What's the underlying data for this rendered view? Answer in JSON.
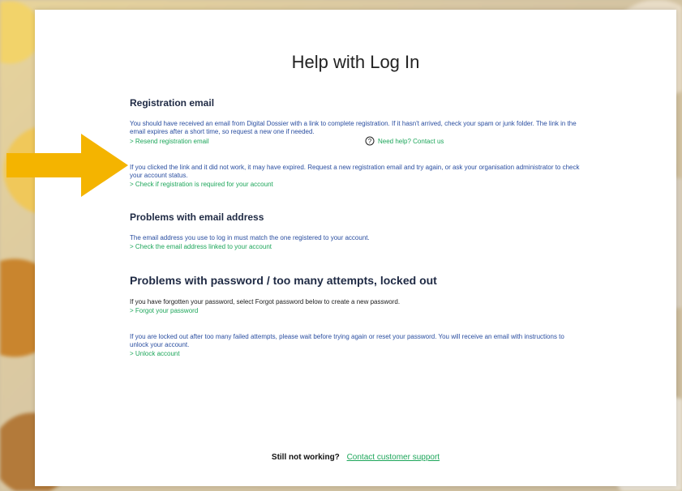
{
  "modal": {
    "title": "Help with Log In"
  },
  "sections": {
    "registration": {
      "title": "Registration email",
      "para1": "You should have received an email from Digital Dossier with a link to complete registration. If it hasn't arrived, check your spam or junk folder. The link in the email expires after a short time, so request a new one if needed.",
      "link_resend": "> Resend registration email",
      "link_help_icon_text": "Need help? Contact us",
      "para2": "If you clicked the link and it did not work, it may have expired. Request a new registration email and try again, or ask your organisation administrator to check your account status.",
      "link_check": "> Check if registration is required for your account"
    },
    "email": {
      "title": "Problems with email address",
      "para1": "The email address you use to log in must match the one registered to your account.",
      "link": "> Check the email address linked to your account"
    },
    "password": {
      "title": "Problems with password / too many attempts, locked out",
      "para1": "If you have forgotten your password, select Forgot password below to create a new password.",
      "link_forgot": "> Forgot your password",
      "para2": "If you are locked out after too many failed attempts, please wait before trying again or reset your password. You will receive an email with instructions to unlock your account.",
      "link_unlock": "> Unlock account"
    }
  },
  "footer": {
    "label": "Still not working?",
    "support_link": "Contact customer support"
  },
  "colors": {
    "link": "#1da65a",
    "body_text": "#2a4ea0",
    "arrow": "#f4b400"
  },
  "icons": {
    "arrow": "arrow-right-icon",
    "help": "question-mark-icon"
  }
}
